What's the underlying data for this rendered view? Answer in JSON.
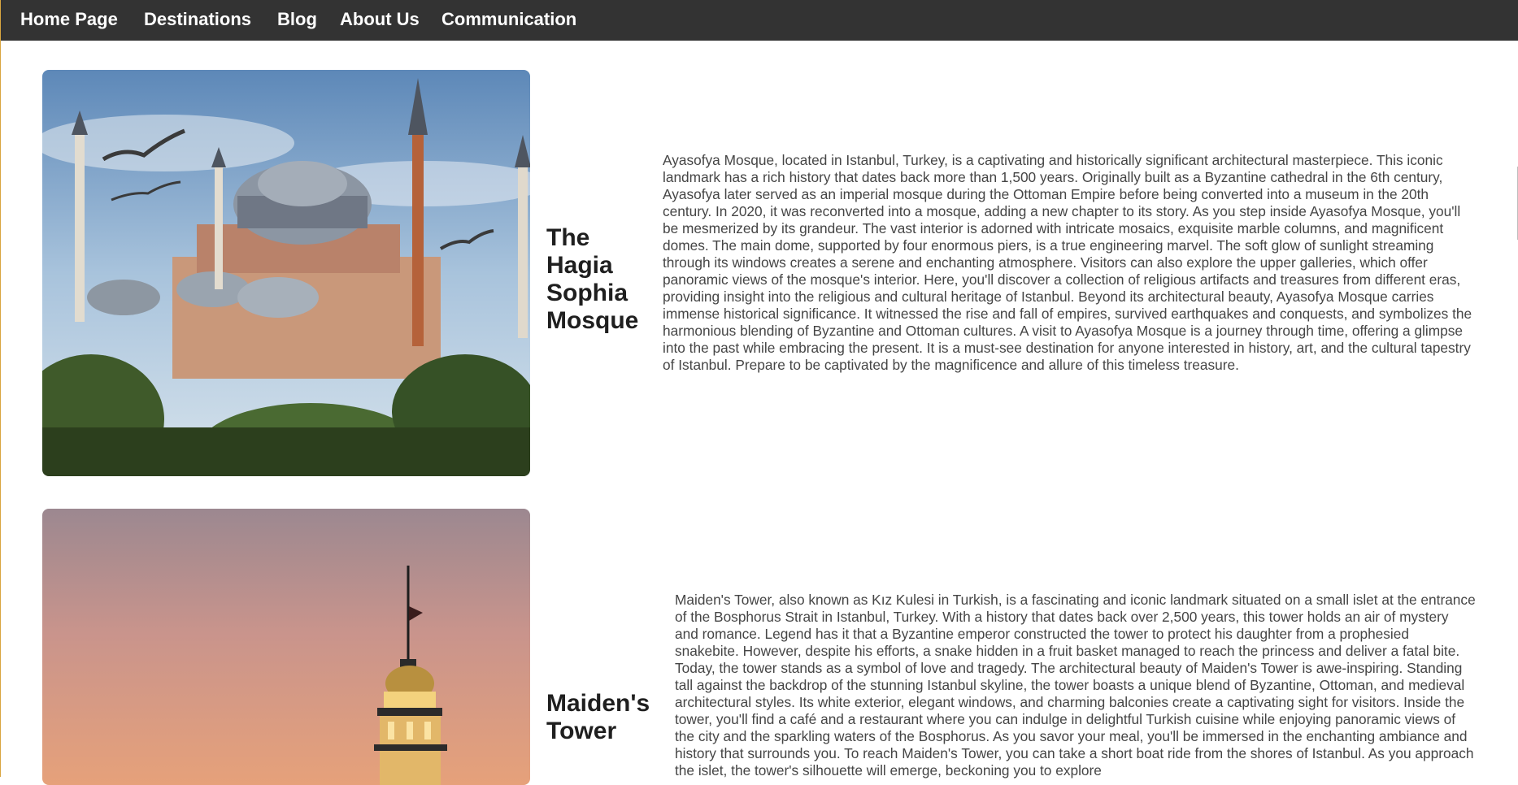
{
  "nav": {
    "items": [
      {
        "label": "Home Page"
      },
      {
        "label": "Destinations"
      },
      {
        "label": "Blog"
      },
      {
        "label": "About Us"
      },
      {
        "label": "Communication"
      }
    ]
  },
  "cards": [
    {
      "image_icon": "hagia-sophia-photo",
      "title": "The Hagia Sophia Mosque",
      "description": "Ayasofya Mosque, located in Istanbul, Turkey, is a captivating and historically significant architectural masterpiece. This iconic landmark has a rich history that dates back more than 1,500 years. Originally built as a Byzantine cathedral in the 6th century, Ayasofya later served as an imperial mosque during the Ottoman Empire before being converted into a museum in the 20th century. In 2020, it was reconverted into a mosque, adding a new chapter to its story. As you step inside Ayasofya Mosque, you'll be mesmerized by its grandeur. The vast interior is adorned with intricate mosaics, exquisite marble columns, and magnificent domes. The main dome, supported by four enormous piers, is a true engineering marvel. The soft glow of sunlight streaming through its windows creates a serene and enchanting atmosphere. Visitors can also explore the upper galleries, which offer panoramic views of the mosque's interior. Here, you'll discover a collection of religious artifacts and treasures from different eras, providing insight into the religious and cultural heritage of Istanbul. Beyond its architectural beauty, Ayasofya Mosque carries immense historical significance. It witnessed the rise and fall of empires, survived earthquakes and conquests, and symbolizes the harmonious blending of Byzantine and Ottoman cultures. A visit to Ayasofya Mosque is a journey through time, offering a glimpse into the past while embracing the present. It is a must-see destination for anyone interested in history, art, and the cultural tapestry of Istanbul. Prepare to be captivated by the magnificence and allure of this timeless treasure."
    },
    {
      "image_icon": "maidens-tower-photo",
      "title": "Maiden's Tower",
      "description": "Maiden's Tower, also known as Kız Kulesi in Turkish, is a fascinating and iconic landmark situated on a small islet at the entrance of the Bosphorus Strait in Istanbul, Turkey. With a history that dates back over 2,500 years, this tower holds an air of mystery and romance. Legend has it that a Byzantine emperor constructed the tower to protect his daughter from a prophesied snakebite. However, despite his efforts, a snake hidden in a fruit basket managed to reach the princess and deliver a fatal bite. Today, the tower stands as a symbol of love and tragedy. The architectural beauty of Maiden's Tower is awe-inspiring. Standing tall against the backdrop of the stunning Istanbul skyline, the tower boasts a unique blend of Byzantine, Ottoman, and medieval architectural styles. Its white exterior, elegant windows, and charming balconies create a captivating sight for visitors. Inside the tower, you'll find a café and a restaurant where you can indulge in delightful Turkish cuisine while enjoying panoramic views of the city and the sparkling waters of the Bosphorus. As you savor your meal, you'll be immersed in the enchanting ambiance and history that surrounds you. To reach Maiden's Tower, you can take a short boat ride from the shores of Istanbul. As you approach the islet, the tower's silhouette will emerge, beckoning you to explore"
    }
  ]
}
